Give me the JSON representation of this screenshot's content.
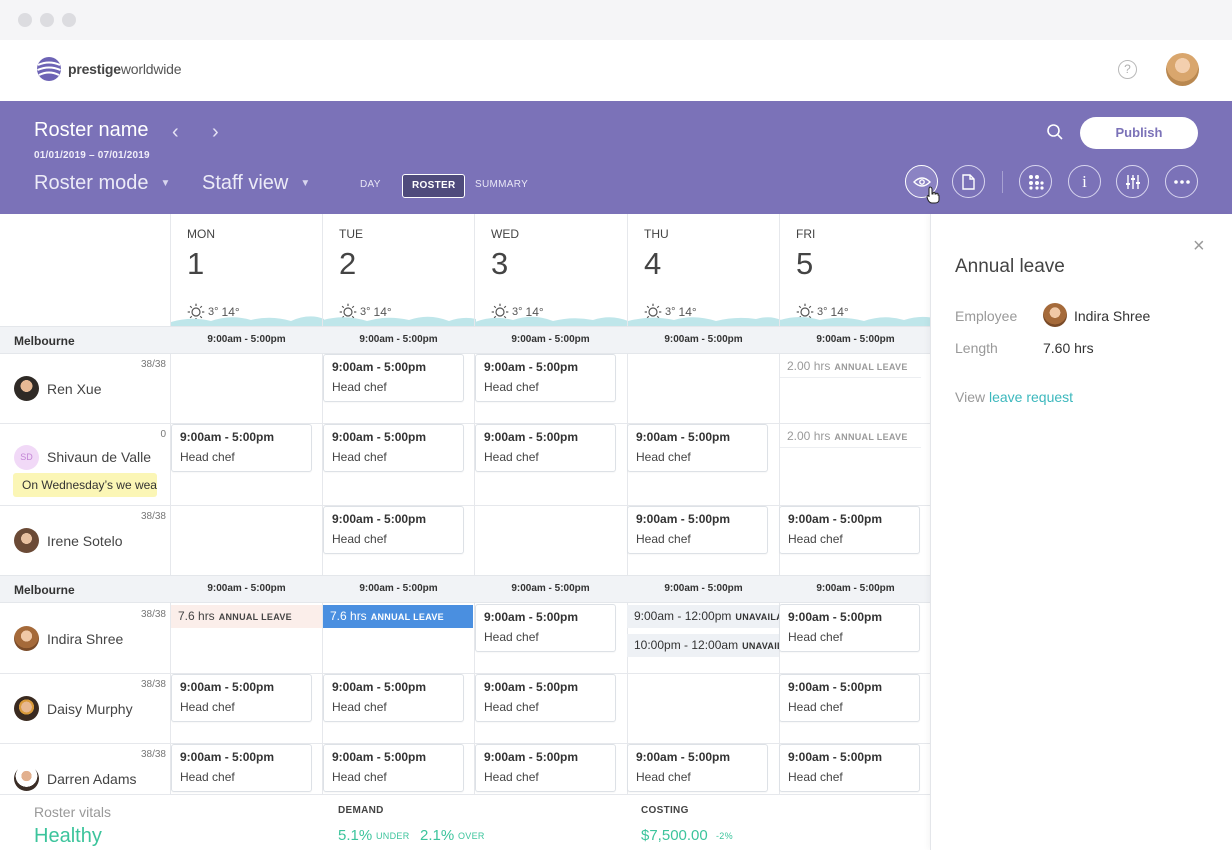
{
  "brand": {
    "bold": "prestige",
    "regular": "worldwide"
  },
  "header": {
    "roster_name": "Roster name",
    "date_range": "01/01/2019 – 07/01/2019",
    "mode": "Roster mode",
    "view": "Staff view",
    "tabs": [
      "DAY",
      "ROSTER",
      "SUMMARY"
    ],
    "active_tab": "ROSTER",
    "publish_label": "Publish"
  },
  "days": [
    {
      "name": "MON",
      "num": "1",
      "low": "3°",
      "high": "14°"
    },
    {
      "name": "TUE",
      "num": "2",
      "low": "3°",
      "high": "14°"
    },
    {
      "name": "WED",
      "num": "3",
      "low": "3°",
      "high": "14°"
    },
    {
      "name": "THU",
      "num": "4",
      "low": "3°",
      "high": "14°"
    },
    {
      "name": "FRI",
      "num": "5",
      "low": "3°",
      "high": "14°"
    }
  ],
  "locations": [
    {
      "name": "Melbourne",
      "hours": [
        "9:00am - 5:00pm",
        "9:00am - 5:00pm",
        "9:00am - 5:00pm",
        "9:00am - 5:00pm",
        "9:00am - 5:00pm"
      ]
    },
    {
      "name": "Melbourne",
      "hours": [
        "9:00am - 5:00pm",
        "9:00am - 5:00pm",
        "9:00am - 5:00pm",
        "9:00am - 5:00pm",
        "9:00am - 5:00pm"
      ]
    }
  ],
  "shift": {
    "time": "9:00am - 5:00pm",
    "role": "Head chef"
  },
  "employees": [
    {
      "name": "Ren Xue",
      "hours": "38/38"
    },
    {
      "name": "Shivaun de Valle",
      "hours": "0",
      "initials": "SD",
      "note": "On Wednesday’s we wear pink"
    },
    {
      "name": "Irene Sotelo",
      "hours": "38/38"
    },
    {
      "name": "Indira Shree",
      "hours": "38/38"
    },
    {
      "name": "Daisy Murphy",
      "hours": "38/38"
    },
    {
      "name": "Darren Adams",
      "hours": "38/38"
    }
  ],
  "leave": {
    "tag": "ANNUAL LEAVE",
    "fri_hours": "2.00 hrs",
    "mon_hours": "7.6 hrs",
    "tue_hours": "7.6 hrs"
  },
  "unavail": {
    "first": "9:00am - 12:00pm",
    "second": "10:00pm - 12:00am",
    "tag": "UNAVAILABLE"
  },
  "vitals": {
    "label": "Roster vitals",
    "status": "Healthy",
    "demand_label": "DEMAND",
    "under_value": "5.1%",
    "under_label": "UNDER",
    "over_value": "2.1%",
    "over_label": "OVER",
    "costing_label": "COSTING",
    "cost_value": "$7,500.00",
    "cost_change": "-2%"
  },
  "panel": {
    "title": "Annual leave",
    "employee_label": "Employee",
    "employee_name": "Indira Shree",
    "length_label": "Length",
    "length_value": "7.60 hrs",
    "view_text": "View",
    "link_text": "leave request"
  },
  "colors": {
    "header_bg": "#7b72b8",
    "accent_green": "#3cc49c",
    "leave_blue": "#4a8fe0",
    "link": "#3cb8bd"
  }
}
